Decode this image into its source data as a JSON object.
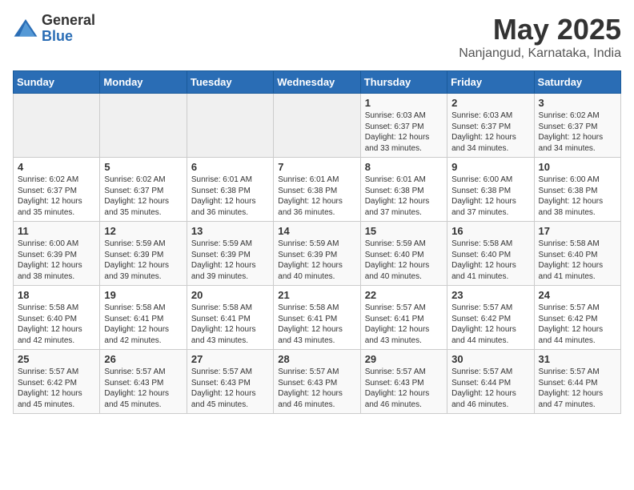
{
  "header": {
    "logo_general": "General",
    "logo_blue": "Blue",
    "title": "May 2025",
    "subtitle": "Nanjangud, Karnataka, India"
  },
  "days_of_week": [
    "Sunday",
    "Monday",
    "Tuesday",
    "Wednesday",
    "Thursday",
    "Friday",
    "Saturday"
  ],
  "weeks": [
    [
      {
        "day": "",
        "info": ""
      },
      {
        "day": "",
        "info": ""
      },
      {
        "day": "",
        "info": ""
      },
      {
        "day": "",
        "info": ""
      },
      {
        "day": "1",
        "info": "Sunrise: 6:03 AM\nSunset: 6:37 PM\nDaylight: 12 hours and 33 minutes."
      },
      {
        "day": "2",
        "info": "Sunrise: 6:03 AM\nSunset: 6:37 PM\nDaylight: 12 hours and 34 minutes."
      },
      {
        "day": "3",
        "info": "Sunrise: 6:02 AM\nSunset: 6:37 PM\nDaylight: 12 hours and 34 minutes."
      }
    ],
    [
      {
        "day": "4",
        "info": "Sunrise: 6:02 AM\nSunset: 6:37 PM\nDaylight: 12 hours and 35 minutes."
      },
      {
        "day": "5",
        "info": "Sunrise: 6:02 AM\nSunset: 6:37 PM\nDaylight: 12 hours and 35 minutes."
      },
      {
        "day": "6",
        "info": "Sunrise: 6:01 AM\nSunset: 6:38 PM\nDaylight: 12 hours and 36 minutes."
      },
      {
        "day": "7",
        "info": "Sunrise: 6:01 AM\nSunset: 6:38 PM\nDaylight: 12 hours and 36 minutes."
      },
      {
        "day": "8",
        "info": "Sunrise: 6:01 AM\nSunset: 6:38 PM\nDaylight: 12 hours and 37 minutes."
      },
      {
        "day": "9",
        "info": "Sunrise: 6:00 AM\nSunset: 6:38 PM\nDaylight: 12 hours and 37 minutes."
      },
      {
        "day": "10",
        "info": "Sunrise: 6:00 AM\nSunset: 6:38 PM\nDaylight: 12 hours and 38 minutes."
      }
    ],
    [
      {
        "day": "11",
        "info": "Sunrise: 6:00 AM\nSunset: 6:39 PM\nDaylight: 12 hours and 38 minutes."
      },
      {
        "day": "12",
        "info": "Sunrise: 5:59 AM\nSunset: 6:39 PM\nDaylight: 12 hours and 39 minutes."
      },
      {
        "day": "13",
        "info": "Sunrise: 5:59 AM\nSunset: 6:39 PM\nDaylight: 12 hours and 39 minutes."
      },
      {
        "day": "14",
        "info": "Sunrise: 5:59 AM\nSunset: 6:39 PM\nDaylight: 12 hours and 40 minutes."
      },
      {
        "day": "15",
        "info": "Sunrise: 5:59 AM\nSunset: 6:40 PM\nDaylight: 12 hours and 40 minutes."
      },
      {
        "day": "16",
        "info": "Sunrise: 5:58 AM\nSunset: 6:40 PM\nDaylight: 12 hours and 41 minutes."
      },
      {
        "day": "17",
        "info": "Sunrise: 5:58 AM\nSunset: 6:40 PM\nDaylight: 12 hours and 41 minutes."
      }
    ],
    [
      {
        "day": "18",
        "info": "Sunrise: 5:58 AM\nSunset: 6:40 PM\nDaylight: 12 hours and 42 minutes."
      },
      {
        "day": "19",
        "info": "Sunrise: 5:58 AM\nSunset: 6:41 PM\nDaylight: 12 hours and 42 minutes."
      },
      {
        "day": "20",
        "info": "Sunrise: 5:58 AM\nSunset: 6:41 PM\nDaylight: 12 hours and 43 minutes."
      },
      {
        "day": "21",
        "info": "Sunrise: 5:58 AM\nSunset: 6:41 PM\nDaylight: 12 hours and 43 minutes."
      },
      {
        "day": "22",
        "info": "Sunrise: 5:57 AM\nSunset: 6:41 PM\nDaylight: 12 hours and 43 minutes."
      },
      {
        "day": "23",
        "info": "Sunrise: 5:57 AM\nSunset: 6:42 PM\nDaylight: 12 hours and 44 minutes."
      },
      {
        "day": "24",
        "info": "Sunrise: 5:57 AM\nSunset: 6:42 PM\nDaylight: 12 hours and 44 minutes."
      }
    ],
    [
      {
        "day": "25",
        "info": "Sunrise: 5:57 AM\nSunset: 6:42 PM\nDaylight: 12 hours and 45 minutes."
      },
      {
        "day": "26",
        "info": "Sunrise: 5:57 AM\nSunset: 6:43 PM\nDaylight: 12 hours and 45 minutes."
      },
      {
        "day": "27",
        "info": "Sunrise: 5:57 AM\nSunset: 6:43 PM\nDaylight: 12 hours and 45 minutes."
      },
      {
        "day": "28",
        "info": "Sunrise: 5:57 AM\nSunset: 6:43 PM\nDaylight: 12 hours and 46 minutes."
      },
      {
        "day": "29",
        "info": "Sunrise: 5:57 AM\nSunset: 6:43 PM\nDaylight: 12 hours and 46 minutes."
      },
      {
        "day": "30",
        "info": "Sunrise: 5:57 AM\nSunset: 6:44 PM\nDaylight: 12 hours and 46 minutes."
      },
      {
        "day": "31",
        "info": "Sunrise: 5:57 AM\nSunset: 6:44 PM\nDaylight: 12 hours and 47 minutes."
      }
    ]
  ]
}
